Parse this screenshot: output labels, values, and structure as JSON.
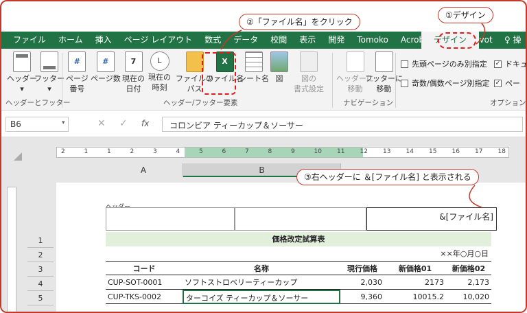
{
  "tabs": [
    "ファイル",
    "ホーム",
    "挿入",
    "ページ レイアウト",
    "数式",
    "データ",
    "校閲",
    "表示",
    "開発",
    "Tomoko",
    "Acrobat",
    "Power Pivot"
  ],
  "active_tab": "デザイン",
  "search_tab": "操",
  "ribbon": {
    "header": "ヘッダー",
    "footer": "フッター",
    "page_number": "ページ\n番号",
    "page_count": "ページ数",
    "current_date": "現在の\n日付",
    "current_time": "現在の\n時刻",
    "file_path": "ファイルの\nパス",
    "file_name": "ファイル名",
    "sheet_name": "シート名",
    "picture": "図",
    "format_picture": "図の\n書式設定",
    "goto_header": "ヘッダーに\n移動",
    "goto_footer": "フッターに\n移動",
    "group_hf": "ヘッダーとフッター",
    "group_elements": "ヘッダー/フッター要素",
    "group_nav": "ナビゲーション",
    "group_options": "オプション",
    "opt_first": "先頭ページのみ別指定",
    "opt_oddeven": "奇数/偶数ページ別指定",
    "opt_doc": "ドキュ",
    "opt_page": "ペー"
  },
  "formula_bar": {
    "name_box": "B6",
    "content": "コロンビア ティーカップ＆ソーサー",
    "fx": "fx"
  },
  "columns": [
    "A",
    "B"
  ],
  "rows": [
    "1",
    "2",
    "3",
    "4",
    "5"
  ],
  "ruler_ticks": [
    "2",
    "1",
    "1",
    "2",
    "3",
    "4",
    "5",
    "6",
    "7",
    "8",
    "9",
    "10",
    "11",
    "12",
    "13",
    "14",
    "15",
    "16",
    "17",
    "18"
  ],
  "header_label": "ヘッダー",
  "header_right": "&[ファイル名]",
  "sheet": {
    "title": "価格改定試算表",
    "date": "××年○月○日",
    "col_headers": [
      "コード",
      "名称",
      "現行価格",
      "新価格01",
      "新価格02"
    ],
    "data": [
      [
        "CUP-SOT-0001",
        "ソフトストロベリーティーカップ",
        "2,030",
        "2173",
        "2,173"
      ],
      [
        "CUP-TKS-0002",
        "ターコイズ ティーカップ＆ソーサー",
        "9,360",
        "10015.2",
        "10,020"
      ]
    ]
  },
  "callouts": {
    "c1": "①デザイン",
    "c2": "②「ファイル名」をクリック",
    "c3": "③右ヘッダーに ＆[ファイル名] と表示される"
  },
  "colors": {
    "excel_green": "#217346",
    "callout_red": "#c0392b"
  }
}
